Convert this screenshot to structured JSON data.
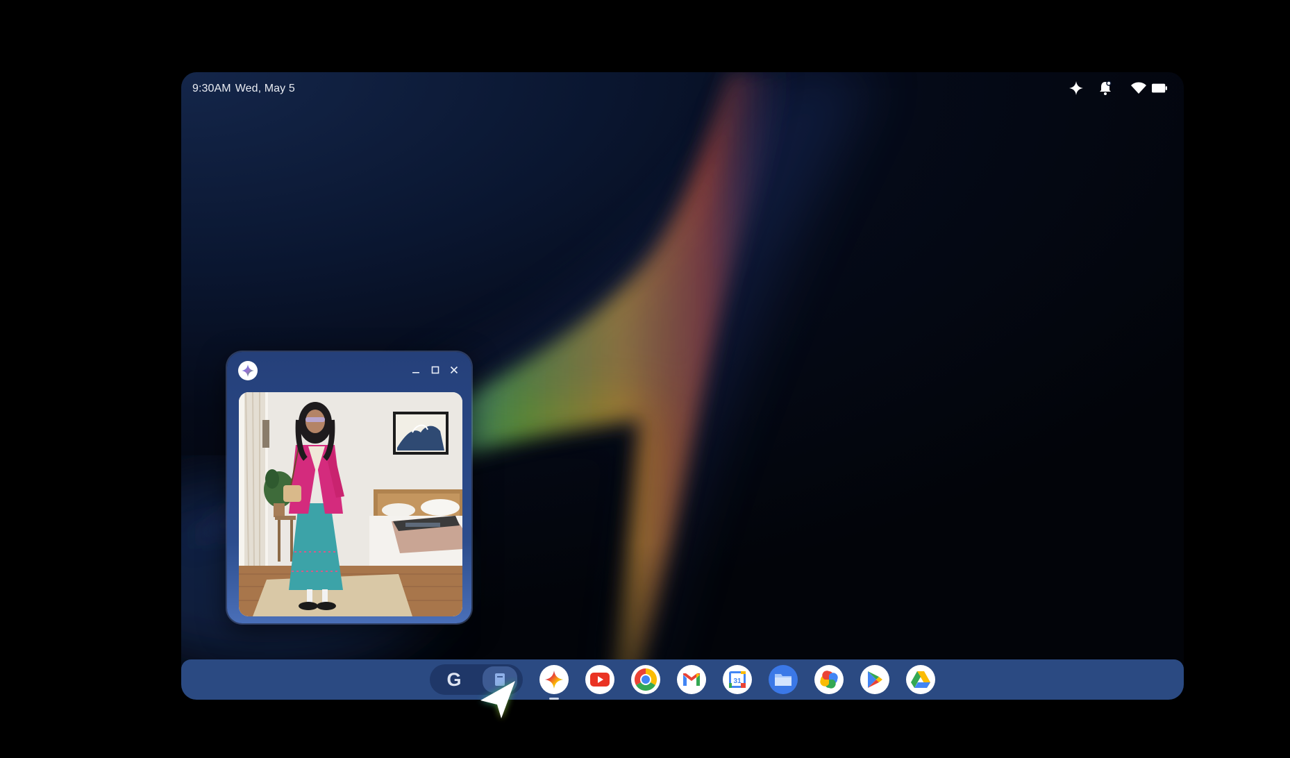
{
  "status_bar": {
    "time": "9:30AM",
    "date": "Wed, May 5",
    "icons": [
      "sparkle-icon",
      "notification-bell-icon",
      "wifi-icon",
      "battery-icon"
    ]
  },
  "floating_window": {
    "app_icon": "gemini-icon",
    "controls": [
      "minimize-icon",
      "maximize-icon",
      "close-icon"
    ],
    "content": "photo-of-woman-in-pink-blazer-in-bedroom"
  },
  "shelf": {
    "launcher_letter": "G",
    "pinned_apps": [
      {
        "name": "Gemini",
        "icon": "gemini-icon",
        "running": true
      },
      {
        "name": "YouTube",
        "icon": "youtube-icon",
        "running": false
      },
      {
        "name": "Chrome",
        "icon": "chrome-icon",
        "running": false
      },
      {
        "name": "Gmail",
        "icon": "gmail-icon",
        "running": false
      },
      {
        "name": "Calendar",
        "icon": "calendar-icon",
        "running": false,
        "label": "31"
      },
      {
        "name": "Files",
        "icon": "files-icon",
        "running": false
      },
      {
        "name": "Photos",
        "icon": "photos-icon",
        "running": false
      },
      {
        "name": "Play Store",
        "icon": "play-store-icon",
        "running": false
      },
      {
        "name": "Drive",
        "icon": "drive-icon",
        "running": false
      }
    ]
  },
  "colors": {
    "shelf": "#2b4a82",
    "accent_blue": "#4285F4",
    "accent_red": "#EA4335",
    "accent_yellow": "#FBBC04",
    "accent_green": "#34A853"
  }
}
